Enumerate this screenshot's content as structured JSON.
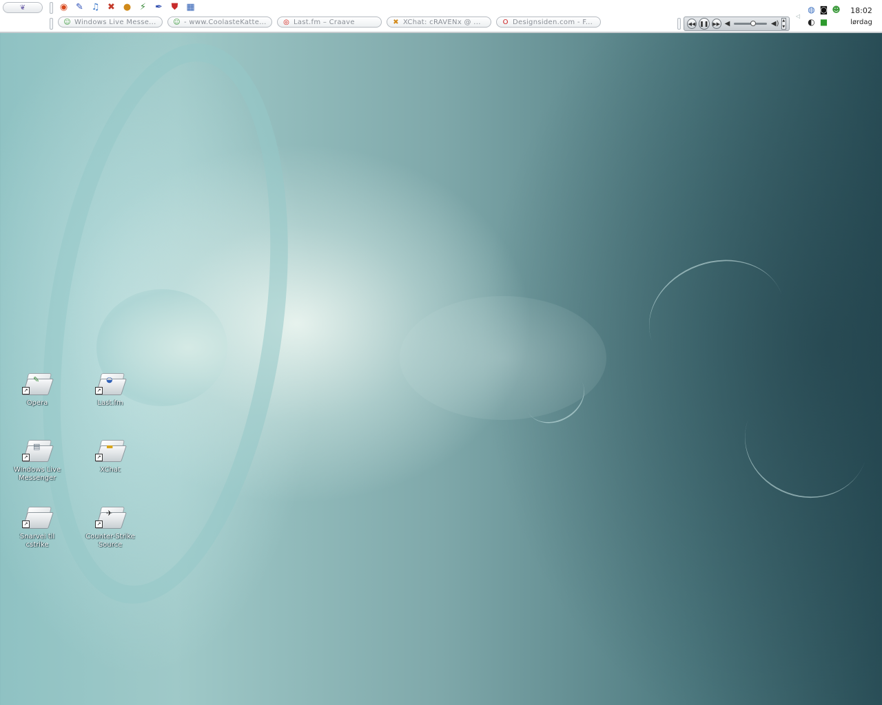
{
  "taskbar": {
    "start_glyph": "❦",
    "quicklaunch": [
      {
        "name": "firefox-icon",
        "glyph": "◉",
        "color": "#d8471b"
      },
      {
        "name": "pin-icon",
        "glyph": "✎",
        "color": "#2c4fb8"
      },
      {
        "name": "itunes-icon",
        "glyph": "♫",
        "color": "#3a78c8"
      },
      {
        "name": "xchat-icon",
        "glyph": "✖",
        "color": "#c33a2a"
      },
      {
        "name": "ball-icon",
        "glyph": "●",
        "color": "#d08a1a"
      },
      {
        "name": "winamp-icon",
        "glyph": "⚡",
        "color": "#3c8a3c"
      },
      {
        "name": "pen-icon",
        "glyph": "✒",
        "color": "#3350b0"
      },
      {
        "name": "shield-icon",
        "glyph": "⛊",
        "color": "#c72b2b"
      },
      {
        "name": "window-icon",
        "glyph": "▦",
        "color": "#2d5db3"
      }
    ],
    "tasks": [
      {
        "name": "task-windows-live-messenger",
        "label": "Windows Live Messe...",
        "icon_name": "messenger-icon",
        "icon_glyph": "☺",
        "icon_color": "#3c9a3c"
      },
      {
        "name": "task-coolastekatte",
        "label": "- www.CoolasteKatte...",
        "icon_name": "messenger-icon",
        "icon_glyph": "☺",
        "icon_color": "#3c9a3c"
      },
      {
        "name": "task-lastfm",
        "label": "Last.fm – Craave",
        "icon_name": "lastfm-icon",
        "icon_glyph": "◎",
        "icon_color": "#d51007"
      },
      {
        "name": "task-xchat",
        "label": "XChat: cRAVENx @ ...",
        "icon_name": "xchat-icon",
        "icon_glyph": "✖",
        "icon_color": "#d38a1a"
      },
      {
        "name": "task-designsiden",
        "label": "Designsiden.com - F...",
        "icon_name": "opera-icon",
        "icon_glyph": "O",
        "icon_color": "#cc1b1b"
      }
    ],
    "player": {
      "prev_glyph": "◀◀",
      "pause_glyph": "❚❚",
      "next_glyph": "▶▶",
      "volume_glyph": "◀",
      "volume_max_glyph": "◀)",
      "volume_level": 0.55
    },
    "tray_arrow": "◁",
    "tray": [
      {
        "name": "network-icon",
        "glyph": "◍",
        "color": "#3a6fc0"
      },
      {
        "name": "steam-icon",
        "glyph": "◙",
        "color": "#111111"
      },
      {
        "name": "msn-status-icon",
        "glyph": "☻",
        "color": "#3c9a3c"
      },
      {
        "name": "globe-icon",
        "glyph": "◐",
        "color": "#222222"
      },
      {
        "name": "color-flag-icon",
        "glyph": "■",
        "color": "#2d9a2d"
      }
    ],
    "clock": {
      "time": "18:02",
      "day": "lørdag"
    }
  },
  "desktop": {
    "icons": [
      {
        "name": "desktop-icon-opera",
        "label": "Opera",
        "badge": "✎",
        "badge_color": "#3a8a3a"
      },
      {
        "name": "desktop-icon-lastfm",
        "label": "Last.fm",
        "badge": "◒",
        "badge_color": "#2f5fb5"
      },
      {
        "name": "desktop-icon-windows-live-messenger",
        "label": "Windows Live Messenger",
        "badge": "▤",
        "badge_color": "#6a7a88"
      },
      {
        "name": "desktop-icon-xchat",
        "label": "XChat",
        "badge": "▬",
        "badge_color": "#d7a41a"
      },
      {
        "name": "desktop-icon-snarvei-cstrike",
        "label": "Snarvei til cstrike",
        "badge": "",
        "badge_color": "#888888"
      },
      {
        "name": "desktop-icon-counter-strike-source",
        "label": "Counter-Strike Source",
        "badge": "✈",
        "badge_color": "#333333"
      }
    ]
  }
}
